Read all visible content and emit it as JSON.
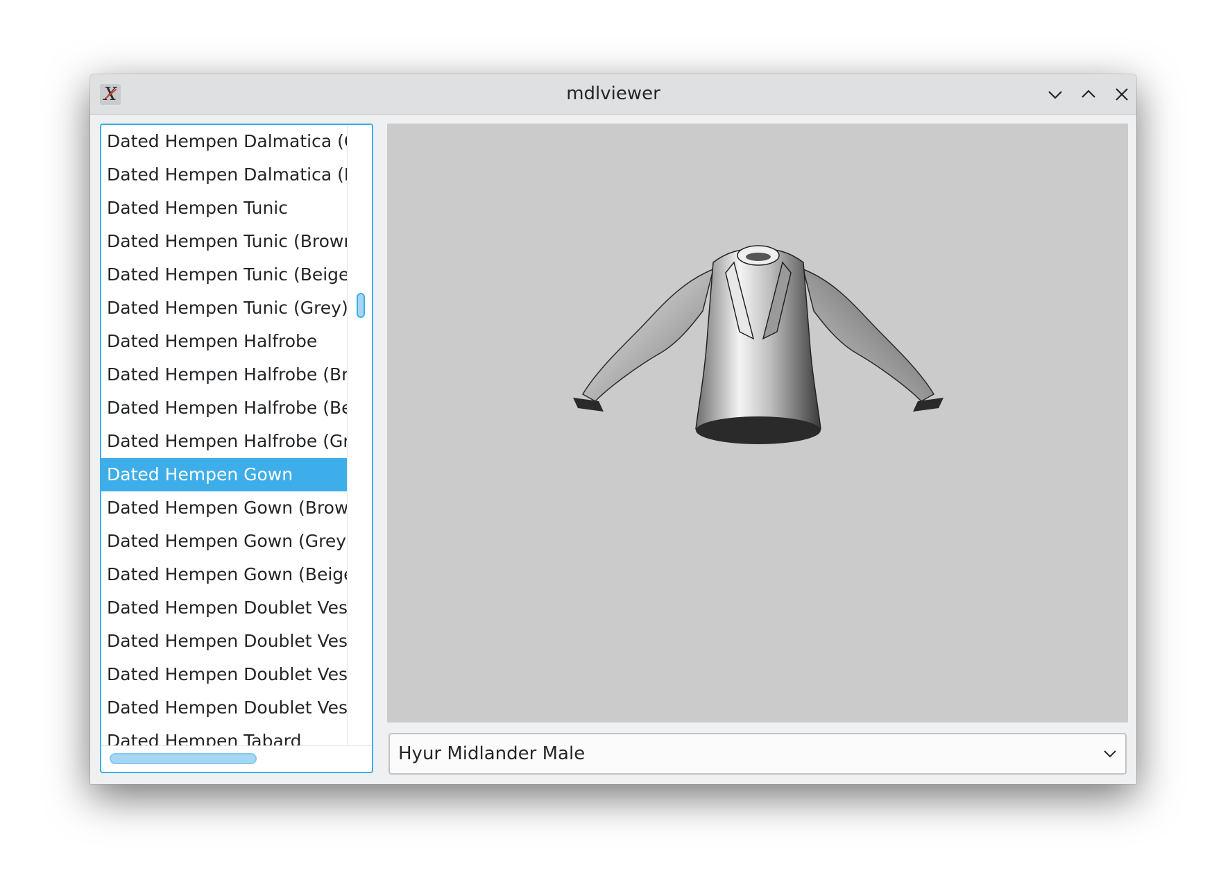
{
  "window": {
    "title": "mdlviewer",
    "app_icon": "x-app-icon",
    "buttons": [
      "minimize-icon",
      "maximize-icon",
      "close-icon"
    ]
  },
  "item_list": {
    "items": [
      "Dated Hempen Dalmatica (G",
      "Dated Hempen Dalmatica (B",
      "Dated Hempen Tunic",
      "Dated Hempen Tunic (Browr",
      "Dated Hempen Tunic (Beige)",
      "Dated Hempen Tunic (Grey)",
      "Dated Hempen Halfrobe",
      "Dated Hempen Halfrobe (Br",
      "Dated Hempen Halfrobe (Be",
      "Dated Hempen Halfrobe (Gr",
      "Dated Hempen Gown",
      "Dated Hempen Gown (Browi",
      "Dated Hempen Gown (Grey)",
      "Dated Hempen Gown (Beige",
      "Dated Hempen Doublet Vest",
      "Dated Hempen Doublet Vest",
      "Dated Hempen Doublet Vest",
      "Dated Hempen Doublet Vest",
      "Dated Hempen Tabard"
    ],
    "selected_index": 10
  },
  "race_select": {
    "value": "Hyur Midlander Male",
    "icon": "chevron-down-icon"
  },
  "colors": {
    "accent": "#3daee9",
    "viewport_bg": "#cbcbcb"
  }
}
